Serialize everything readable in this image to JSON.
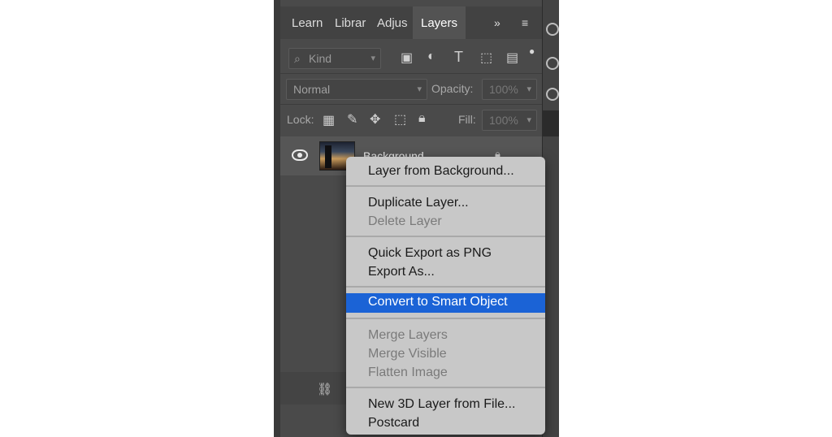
{
  "tabs": [
    {
      "label": "Learn"
    },
    {
      "label": "Librar"
    },
    {
      "label": "Adjus"
    },
    {
      "label": "Layers"
    }
  ],
  "tab_overflow_label": "»",
  "filter": {
    "placeholder": "Kind"
  },
  "blend_mode": {
    "value": "Normal"
  },
  "opacity": {
    "label": "Opacity:",
    "value": "100%"
  },
  "lock": {
    "label": "Lock:"
  },
  "fill": {
    "label": "Fill:",
    "value": "100%"
  },
  "layer": {
    "name": "Background"
  },
  "context_menu": {
    "groups": [
      [
        "Layer from Background..."
      ],
      [
        "Duplicate Layer...",
        "Delete Layer"
      ],
      [
        "Quick Export as PNG",
        "Export As..."
      ],
      [
        "Convert to Smart Object"
      ],
      [
        "Merge Layers",
        "Merge Visible",
        "Flatten Image"
      ],
      [
        "New 3D Layer from File...",
        "Postcard"
      ]
    ],
    "disabled": [
      "Delete Layer",
      "Merge Layers",
      "Merge Visible",
      "Flatten Image"
    ],
    "highlighted": "Convert to Smart Object",
    "highlight_color": "#1b63d6"
  }
}
